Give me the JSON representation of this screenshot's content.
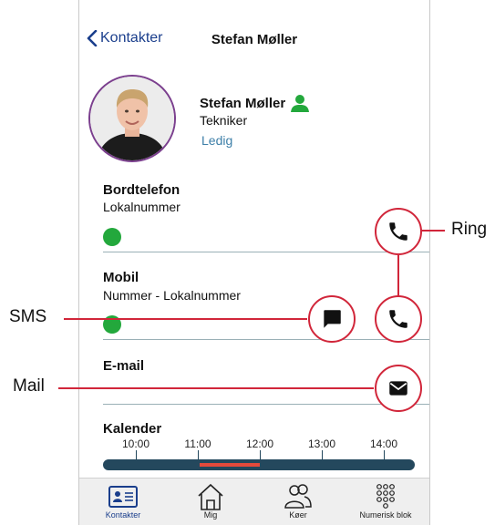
{
  "nav": {
    "back_label": "Kontakter",
    "title": "Stefan Møller"
  },
  "profile": {
    "name": "Stefan Møller",
    "job_title": "Tekniker",
    "status": "Ledig",
    "status_color": "#23a83c"
  },
  "sections": {
    "desk_phone": {
      "label": "Bordtelefon",
      "sub": "Lokalnummer"
    },
    "mobile": {
      "label": "Mobil",
      "sub": "Nummer - Lokalnummer"
    },
    "email": {
      "label": "E-mail"
    },
    "calendar": {
      "label": "Kalender",
      "ticks": [
        "10:00",
        "11:00",
        "12:00",
        "13:00",
        "14:00"
      ]
    }
  },
  "callouts": {
    "ring": "Ring",
    "sms": "SMS",
    "mail": "Mail"
  },
  "tabs": [
    {
      "label": "Kontakter",
      "icon": "contact-card-icon"
    },
    {
      "label": "Mig",
      "icon": "house-icon"
    },
    {
      "label": "Køer",
      "icon": "people-icon"
    },
    {
      "label": "Numerisk blok",
      "icon": "keypad-icon"
    }
  ],
  "colors": {
    "accent": "#1a3e8c",
    "callout": "#d1263a",
    "available": "#23a83c",
    "timeline": "#24485d",
    "busy": "#e44a3c"
  }
}
